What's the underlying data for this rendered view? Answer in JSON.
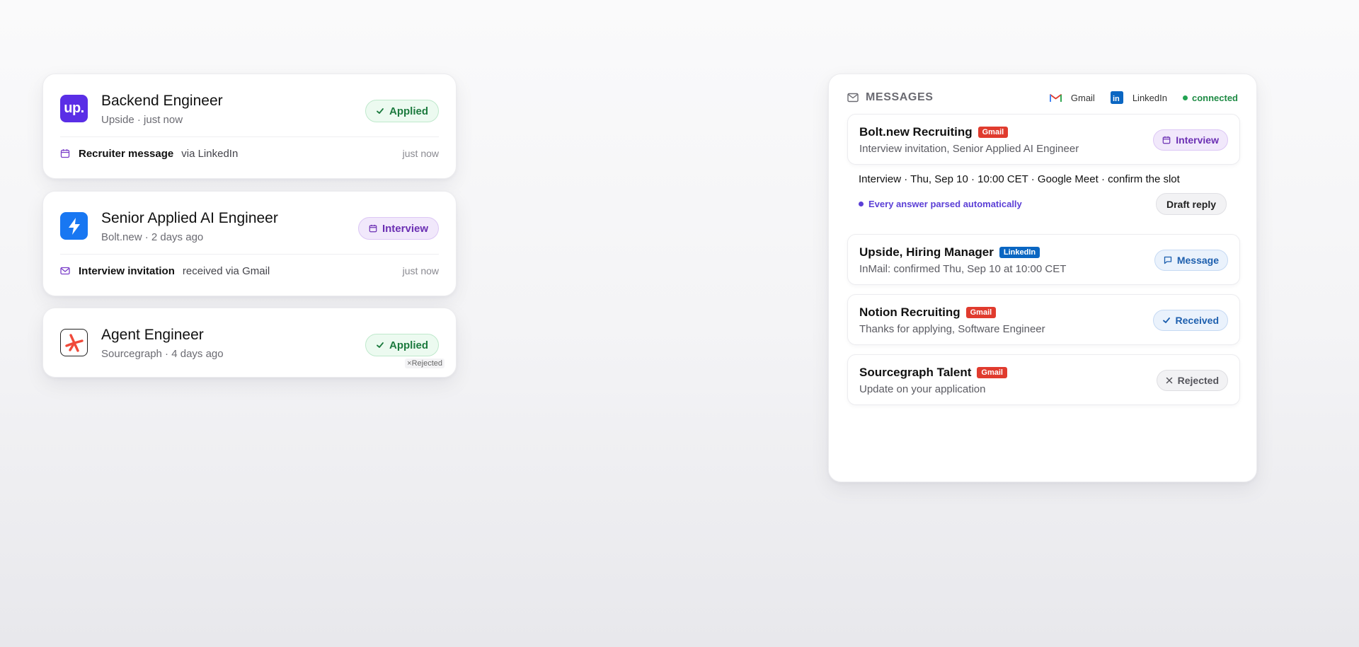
{
  "jobs": [
    {
      "title": "Backend Engineer",
      "subtitle": "Upside · just now",
      "logo_text": "up.",
      "logo_color": "#5a2ee6",
      "status": "Applied",
      "event": {
        "icon": "calendar-icon",
        "label": "Recruiter message",
        "via": "via LinkedIn",
        "time": "just now"
      }
    },
    {
      "title": "Senior Applied AI Engineer",
      "subtitle": "Bolt.new · 2 days ago",
      "logo_color": "#1877f2",
      "status": "Interview",
      "event": {
        "icon": "mail-icon",
        "label": "Interview invitation",
        "via": "received via Gmail",
        "time": "just now"
      }
    },
    {
      "title": "Agent Engineer",
      "subtitle": "Sourcegraph · 4 days ago",
      "status": "Applied",
      "tag": "×Rejected"
    }
  ],
  "messages_panel": {
    "title": "MESSAGES",
    "sources": [
      "Gmail",
      "LinkedIn"
    ],
    "connection": "connected",
    "items": [
      {
        "sender": "Bolt.new Recruiting",
        "source": "Gmail",
        "preview": "Interview invitation, Senior Applied AI Engineer",
        "status": "Interview"
      },
      {
        "sender": "Upside, Hiring Manager",
        "source": "LinkedIn",
        "preview": "InMail: confirmed Thu, Sep 10 at 10:00 CET",
        "status": "Message"
      },
      {
        "sender": "Notion Recruiting",
        "source": "Gmail",
        "preview": "Thanks for applying, Software Engineer",
        "status": "Received"
      },
      {
        "sender": "Sourcegraph Talent",
        "source": "Gmail",
        "preview": "Update on your application",
        "status": "Rejected"
      }
    ],
    "detail": {
      "line": "Interview · Thu, Sep 10 · 10:00 CET · Google Meet · confirm the slot",
      "parse_note": "Every answer parsed automatically",
      "action_label": "Draft reply"
    }
  },
  "colors": {
    "applied": "#1c7a3e",
    "interview": "#6b2fb3",
    "gmail": "#e03b2e",
    "linkedin": "#0a66c2",
    "connected": "#22a352",
    "accent": "#5b3fd6"
  }
}
